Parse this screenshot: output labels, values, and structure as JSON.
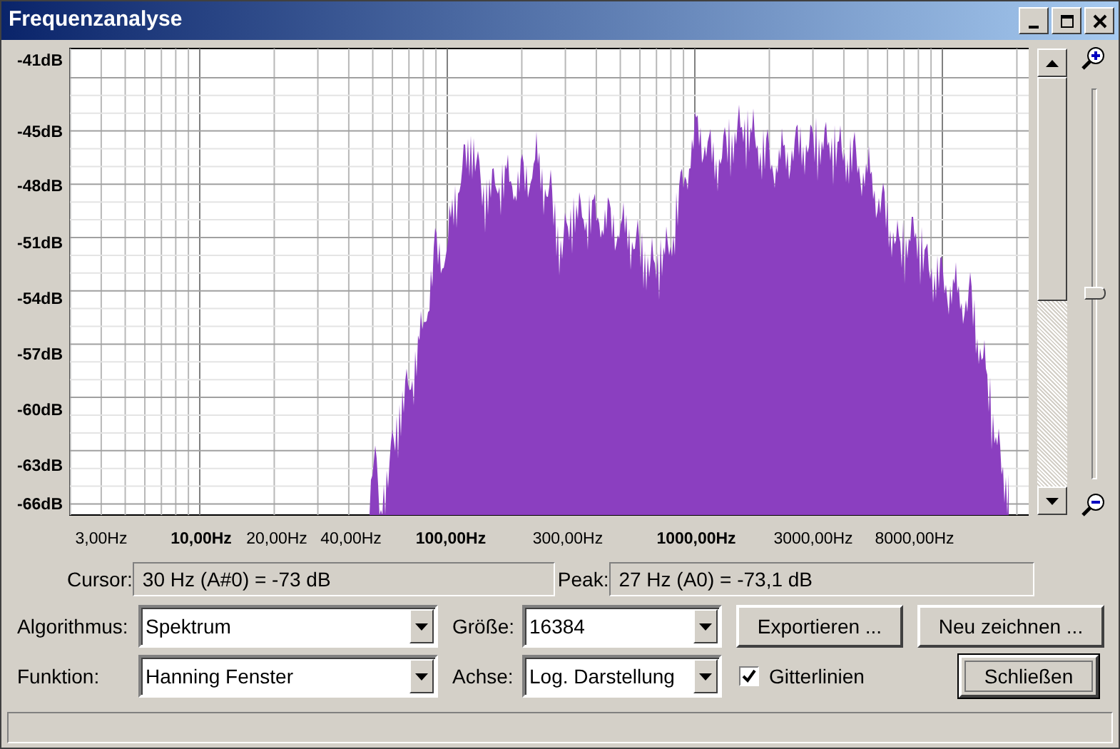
{
  "window": {
    "title": "Frequenzanalyse"
  },
  "plot": {
    "y_ticks": [
      "-41dB",
      "-45dB",
      "-48dB",
      "-51dB",
      "-54dB",
      "-57dB",
      "-60dB",
      "-63dB",
      "-66dB"
    ],
    "x_ticks": [
      {
        "label": "3,00Hz",
        "major": false
      },
      {
        "label": "10,00Hz",
        "major": true
      },
      {
        "label": "20,00Hz",
        "major": false
      },
      {
        "label": "40,00Hz",
        "major": false
      },
      {
        "label": "100,00Hz",
        "major": true
      },
      {
        "label": "300,00Hz",
        "major": false
      },
      {
        "label": "1000,00Hz",
        "major": true
      },
      {
        "label": "3000,00Hz",
        "major": false
      },
      {
        "label": "8000,00Hz",
        "major": false
      }
    ]
  },
  "zoom_slider": {
    "level": 0.48
  },
  "readouts": [
    {
      "label": "Cursor:",
      "value": "30 Hz (A#0) = -73 dB"
    },
    {
      "label": "Peak:",
      "value": "27 Hz (A0) = -73,1 dB"
    }
  ],
  "settings": [
    {
      "label": "Algorithmus:",
      "value": "Spektrum"
    },
    {
      "label": "Größe:",
      "value": "16384"
    },
    {
      "label": "Funktion:",
      "value": "Hanning Fenster"
    },
    {
      "label": "Achse:",
      "value": "Log. Darstellung"
    }
  ],
  "buttons": [
    {
      "label": "Exportieren ...",
      "default": false
    },
    {
      "label": "Neu zeichnen ...",
      "default": false
    },
    {
      "label": "Schließen",
      "default": true
    }
  ],
  "gridlines": {
    "label": "Gitterlinien",
    "checked": true
  }
}
